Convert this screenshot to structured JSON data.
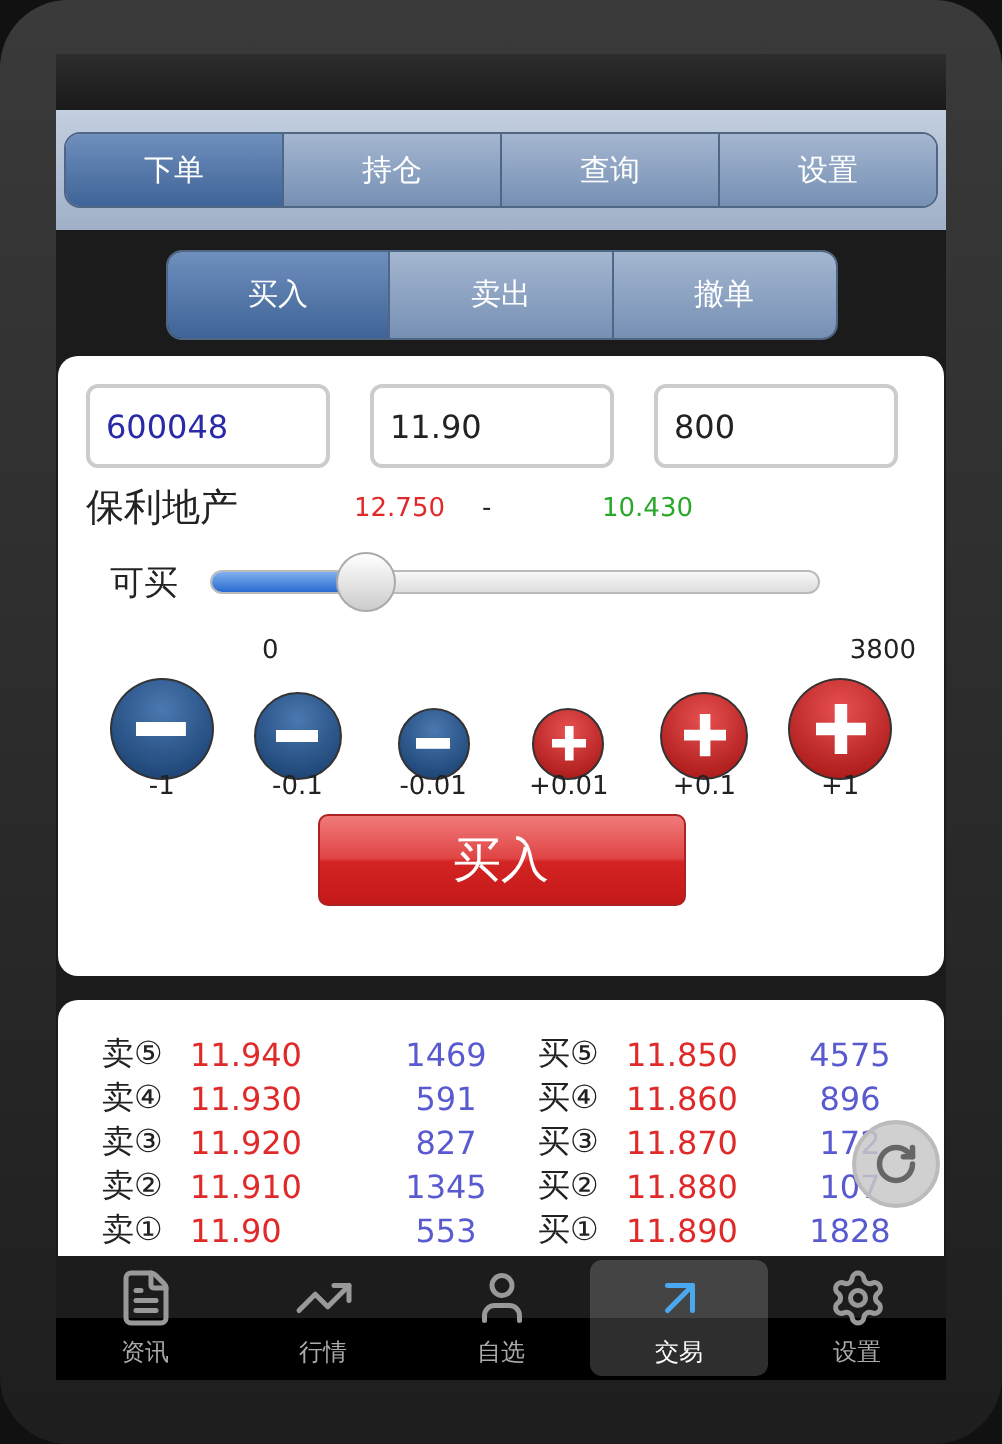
{
  "main_tabs": [
    {
      "label": "下单",
      "selected": true
    },
    {
      "label": "持仓",
      "selected": false
    },
    {
      "label": "查询",
      "selected": false
    },
    {
      "label": "设置",
      "selected": false
    }
  ],
  "sub_tabs": [
    {
      "label": "买入",
      "selected": true
    },
    {
      "label": "卖出",
      "selected": false
    },
    {
      "label": "撤单",
      "selected": false
    }
  ],
  "fields": [
    {
      "value": "600048",
      "kind": "code"
    },
    {
      "value": "11.90",
      "kind": "price"
    },
    {
      "value": "800",
      "kind": "quantity"
    }
  ],
  "stock": {
    "name": "保利地产",
    "high": "12.750",
    "separator": "-",
    "low": "10.430"
  },
  "slider": {
    "label": "可买",
    "level": 0.23,
    "min": "0",
    "max": "3800"
  },
  "steppers": [
    {
      "kind": "minus",
      "label": "-1"
    },
    {
      "kind": "minus",
      "label": "-0.1"
    },
    {
      "kind": "minus",
      "label": "-0.01"
    },
    {
      "kind": "plus",
      "label": "+0.01"
    },
    {
      "kind": "plus",
      "label": "+0.1"
    },
    {
      "kind": "plus",
      "label": "+1"
    }
  ],
  "submit_button": "买入",
  "order_book": [
    {
      "sell_label": "卖⑤",
      "sell_price": "11.940",
      "sell_volume": "1469",
      "buy_label": "买⑤",
      "buy_price": "11.850",
      "buy_volume": "4575"
    },
    {
      "sell_label": "卖④",
      "sell_price": "11.930",
      "sell_volume": "591",
      "buy_label": "买④",
      "buy_price": "11.860",
      "buy_volume": "896"
    },
    {
      "sell_label": "卖③",
      "sell_price": "11.920",
      "sell_volume": "827",
      "buy_label": "买③",
      "buy_price": "11.870",
      "buy_volume": "172"
    },
    {
      "sell_label": "卖②",
      "sell_price": "11.910",
      "sell_volume": "1345",
      "buy_label": "买②",
      "buy_price": "11.880",
      "buy_volume": "107"
    },
    {
      "sell_label": "卖①",
      "sell_price": "11.90",
      "sell_volume": "553",
      "buy_label": "买①",
      "buy_price": "11.890",
      "buy_volume": "1828"
    }
  ],
  "bottom_tabs": [
    {
      "label": "资讯",
      "kind": "news",
      "selected": false
    },
    {
      "label": "行情",
      "kind": "market",
      "selected": false
    },
    {
      "label": "自选",
      "kind": "watchlist",
      "selected": false
    },
    {
      "label": "交易",
      "kind": "trade",
      "selected": true
    },
    {
      "label": "设置",
      "kind": "settings",
      "selected": false
    }
  ]
}
